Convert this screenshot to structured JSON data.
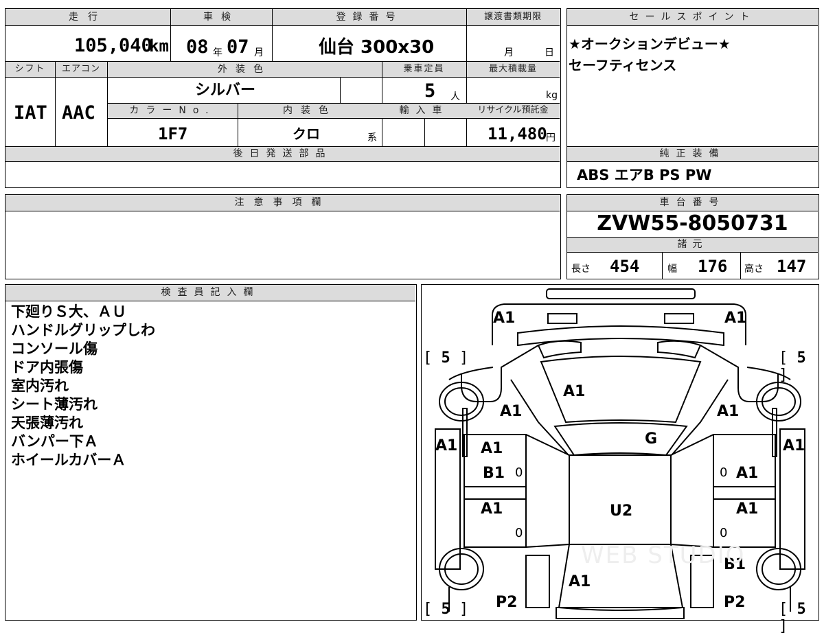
{
  "top": {
    "mileage": {
      "label": "走行",
      "value": "105,040",
      "unit": "km"
    },
    "inspection": {
      "label": "車検",
      "year": "08",
      "year_unit": "年",
      "month": "07",
      "month_unit": "月"
    },
    "registration": {
      "label": "登録番号",
      "value": "仙台 300ⅹ30"
    },
    "transfer": {
      "label": "譲渡書類期限",
      "month_unit": "月",
      "day_unit": "日"
    },
    "shift": {
      "label": "シフト",
      "value": "IAT"
    },
    "aircon": {
      "label": "エアコン",
      "value": "AAC"
    },
    "exterior": {
      "label": "外装色",
      "value": "シルバー"
    },
    "capacity": {
      "label": "乗車定員",
      "value": "5",
      "unit": "人"
    },
    "max_load": {
      "label": "最大積載量",
      "unit": "kg"
    },
    "color_no": {
      "label": "カラーNo.",
      "value": "1F7"
    },
    "interior": {
      "label": "内装色",
      "value": "クロ",
      "suffix": "系"
    },
    "import": {
      "label": "輸入車"
    },
    "recycle": {
      "label": "リサイクル預託金",
      "value": "11,480",
      "unit": "円"
    },
    "later_parts": {
      "label": "後日発送部品"
    }
  },
  "sales_point": {
    "label": "セールスポイント",
    "lines": [
      "★オークションデビュー★",
      "セーフティセンス"
    ]
  },
  "equipment": {
    "label": "純正装備",
    "value": "ABS エアB PS PW"
  },
  "notes": {
    "label": "注意事項欄"
  },
  "chassis": {
    "label": "車台番号",
    "value": "ZVW55-8050731"
  },
  "specs": {
    "label": "諸元",
    "length_label": "長さ",
    "length": "454",
    "width_label": "幅",
    "width": "176",
    "height_label": "高さ",
    "height": "147"
  },
  "inspector": {
    "label": "検査員記入欄",
    "lines": [
      "下廻りＳ大、ＡＵ",
      "ハンドルグリップしわ",
      "コンソール傷",
      "ドア内張傷",
      "室内汚れ",
      "シート薄汚れ",
      "天張薄汚れ",
      "バンパー下Ａ",
      "ホイールカバーＡ"
    ]
  },
  "diagram": {
    "codes": {
      "front_left": "A1",
      "front_right": "A1",
      "hood": "A1",
      "fender_left": "A1",
      "fender_right": "A1",
      "windshield": "G",
      "pillar_left": "A1",
      "pillar_right": "A1",
      "door_fl": "A1",
      "door_fl2": "B1",
      "door_fr": "A1",
      "door_rl": "A1",
      "door_rr": "A1",
      "roof": "U2",
      "rear_right": "B1",
      "trunk": "A1",
      "rear_left_p": "P2",
      "rear_right_p": "P2"
    },
    "tires": {
      "fl": "5",
      "fr": "5",
      "rl": "5",
      "rr": "5"
    },
    "zeros": "0",
    "watermark": "WEB STUDIO"
  }
}
